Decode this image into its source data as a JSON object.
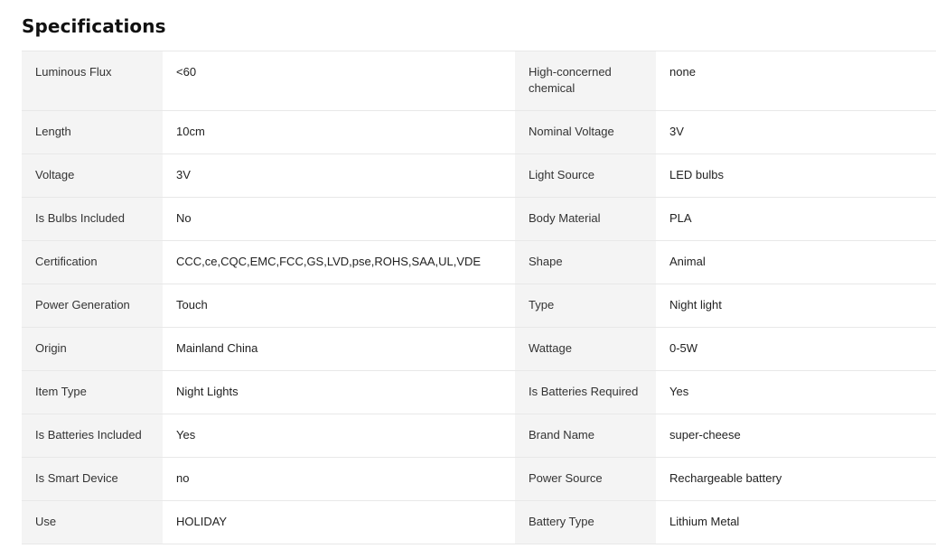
{
  "section_title": "Specifications",
  "rows": [
    {
      "left_key": "Luminous Flux",
      "left_value": "<60",
      "right_key": "High-concerned chemical",
      "right_value": "none"
    },
    {
      "left_key": "Length",
      "left_value": "10cm",
      "right_key": "Nominal Voltage",
      "right_value": "3V"
    },
    {
      "left_key": "Voltage",
      "left_value": "3V",
      "right_key": "Light Source",
      "right_value": "LED bulbs"
    },
    {
      "left_key": "Is Bulbs Included",
      "left_value": "No",
      "right_key": "Body Material",
      "right_value": "PLA"
    },
    {
      "left_key": "Certification",
      "left_value": "CCC,ce,CQC,EMC,FCC,GS,LVD,pse,ROHS,SAA,UL,VDE",
      "right_key": "Shape",
      "right_value": "Animal"
    },
    {
      "left_key": "Power Generation",
      "left_value": "Touch",
      "right_key": "Type",
      "right_value": "Night light"
    },
    {
      "left_key": "Origin",
      "left_value": "Mainland China",
      "right_key": "Wattage",
      "right_value": "0-5W"
    },
    {
      "left_key": "Item Type",
      "left_value": "Night Lights",
      "right_key": "Is Batteries Required",
      "right_value": "Yes"
    },
    {
      "left_key": "Is Batteries Included",
      "left_value": "Yes",
      "right_key": "Brand Name",
      "right_value": "super-cheese"
    },
    {
      "left_key": "Is Smart Device",
      "left_value": "no",
      "right_key": "Power Source",
      "right_value": "Rechargeable battery"
    },
    {
      "left_key": "Use",
      "left_value": "HOLIDAY",
      "right_key": "Battery Type",
      "right_value": "Lithium Metal"
    }
  ]
}
